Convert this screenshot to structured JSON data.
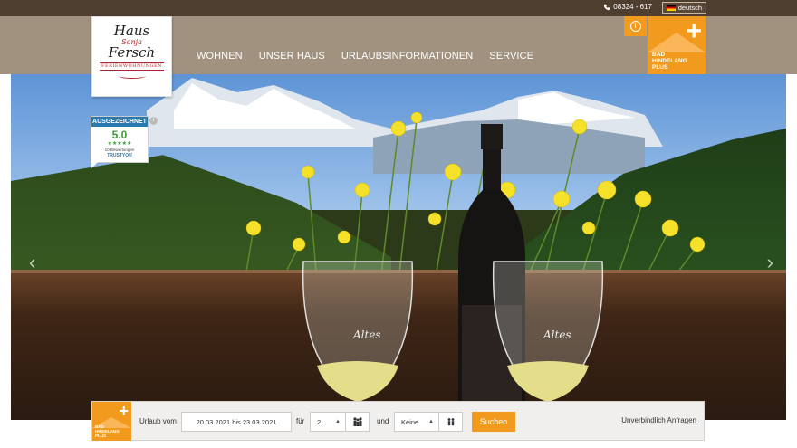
{
  "topbar": {
    "phone_icon": "phone-icon",
    "phone": "08324 - 617",
    "language": "deutsch",
    "flag_icon": "german-flag-icon"
  },
  "logo": {
    "line1": "Haus",
    "line2": "Sonja",
    "line3": "Fersch",
    "line4": "FERIENWOHNUNGEN"
  },
  "nav": {
    "items": [
      "WOHNEN",
      "UNSER HAUS",
      "URLAUBSINFORMATIONEN",
      "SERVICE"
    ]
  },
  "badge": {
    "info_icon": "info-icon",
    "line1": "BAD",
    "line2": "HINDELANG",
    "line3": "PLUS"
  },
  "trust": {
    "header": "AUSGEZEICHNET",
    "score": "5.0",
    "stars": "★★★★★",
    "reviews": "10 Bewertungen",
    "brand": "TRUSTYOU"
  },
  "booking": {
    "logo_line1": "BAD",
    "logo_line2": "HINDELANG",
    "logo_line3": "PLUS",
    "label_from": "Urlaub vom",
    "dates": "20.03.2021 bis 23.03.2021",
    "label_for": "für",
    "adults": "2",
    "adults_icon": "adults-icon",
    "label_and": "und",
    "children": "Keine",
    "children_icon": "children-icon",
    "search": "Suchen",
    "inquiry": "Unverbindlich Anfragen"
  },
  "colors": {
    "accent": "#f29a1d",
    "header": "#a0927f",
    "topbar": "#4e3e30"
  }
}
